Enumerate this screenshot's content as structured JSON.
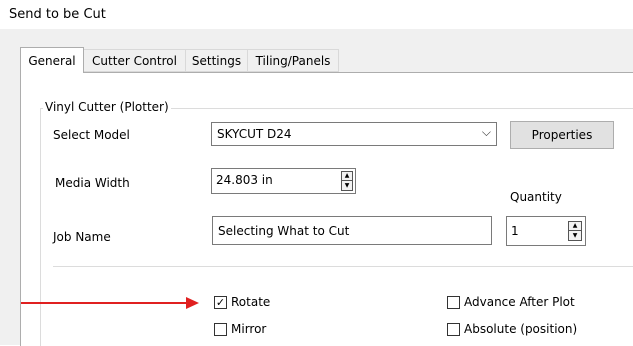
{
  "window": {
    "title": "Send to be Cut"
  },
  "tabs": [
    {
      "label": "General",
      "active": true
    },
    {
      "label": "Cutter Control",
      "active": false
    },
    {
      "label": "Settings",
      "active": false
    },
    {
      "label": "Tiling/Panels",
      "active": false
    }
  ],
  "vinyl_cutter": {
    "group_label": "Vinyl Cutter (Plotter)",
    "select_model_label": "Select Model",
    "model_value": "SKYCUT D24",
    "properties_button": "Properties",
    "media_width_label": "Media Width",
    "media_width_value": "24.803 in",
    "quantity_label": "Quantity",
    "quantity_value": "1",
    "job_name_label": "Job Name",
    "job_name_value": "Selecting What to  Cut"
  },
  "options": {
    "rotate": {
      "label": "Rotate",
      "checked": true
    },
    "mirror": {
      "label": "Mirror",
      "checked": false
    },
    "advance_after_plot": {
      "label": "Advance After Plot",
      "checked": false
    },
    "absolute_position": {
      "label": "Absolute (position)",
      "checked": false
    }
  },
  "annotation": {
    "arrow_color": "#e02020"
  },
  "icons": {
    "check": "✓",
    "dropdown": "⌵",
    "spin_up": "▲",
    "spin_down": "▼"
  }
}
